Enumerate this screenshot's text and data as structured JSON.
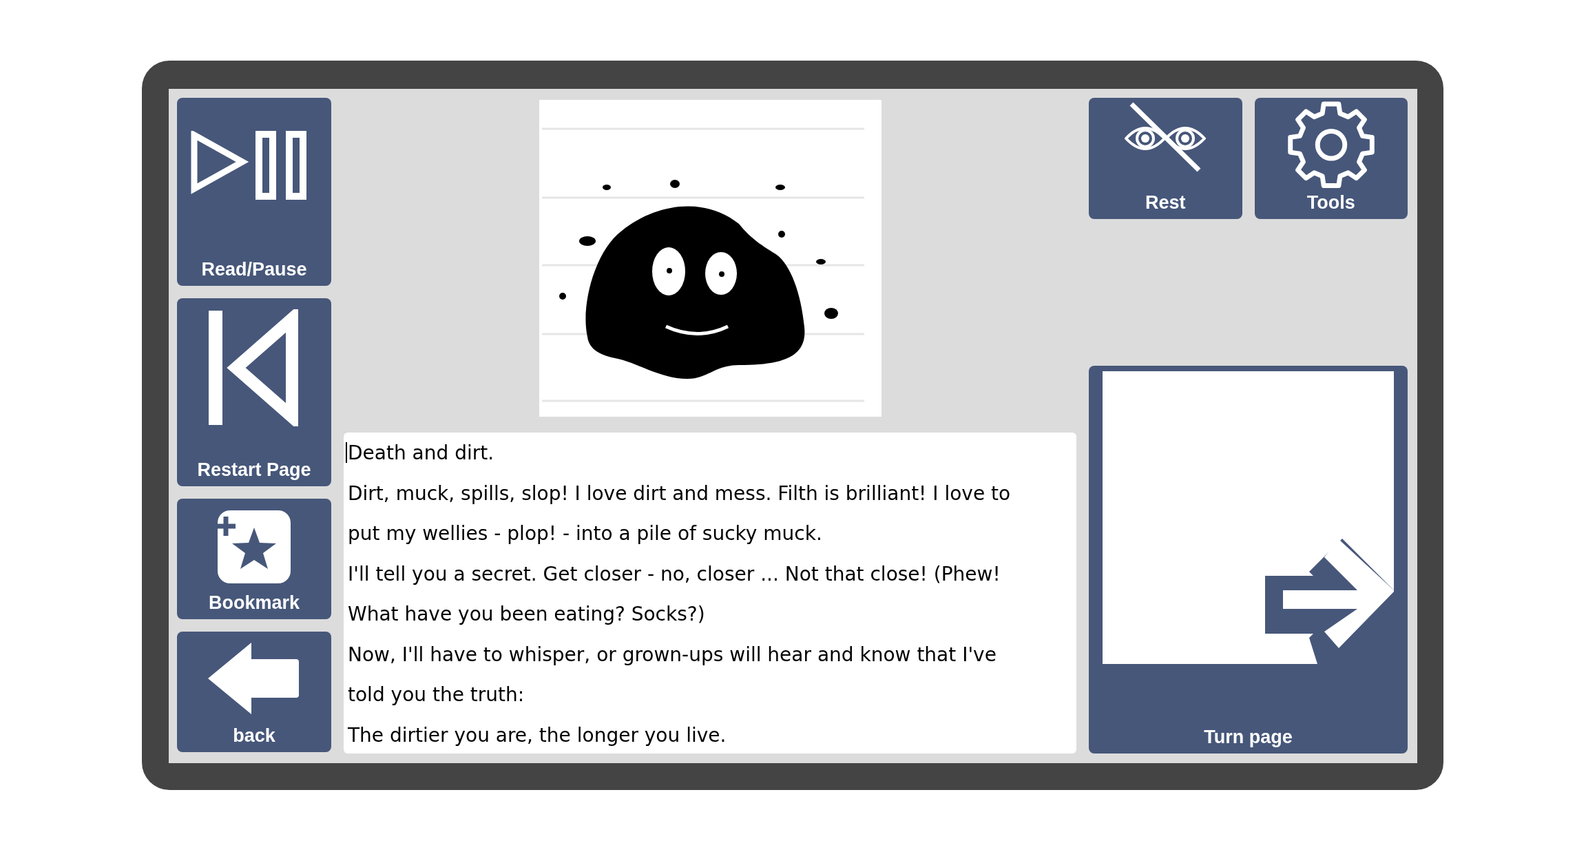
{
  "left_buttons": [
    {
      "kind": "play-pause",
      "label": "Read/Pause"
    },
    {
      "kind": "restart",
      "label": "Restart Page"
    },
    {
      "kind": "bookmark",
      "label": "Bookmark"
    },
    {
      "kind": "back",
      "label": "back"
    }
  ],
  "top_buttons": [
    {
      "kind": "rest",
      "label": "Rest"
    },
    {
      "kind": "tools",
      "label": "Tools"
    }
  ],
  "text_lines": [
    "Death and dirt.",
    "Dirt, muck, spills, slop! I love dirt and mess. Filth is brilliant! I love to",
    "put my wellies - plop! - into a pile of sucky muck.",
    "I'll tell you a secret. Get closer - no, closer ... Not that close! (Phew!",
    "What have you been eating? Socks?)",
    "Now, I'll have to whisper, or grown-ups will hear and know that I've",
    "told you the truth:",
    "The dirtier you are, the longer you live."
  ],
  "turn_page": {
    "label": "Turn page"
  }
}
